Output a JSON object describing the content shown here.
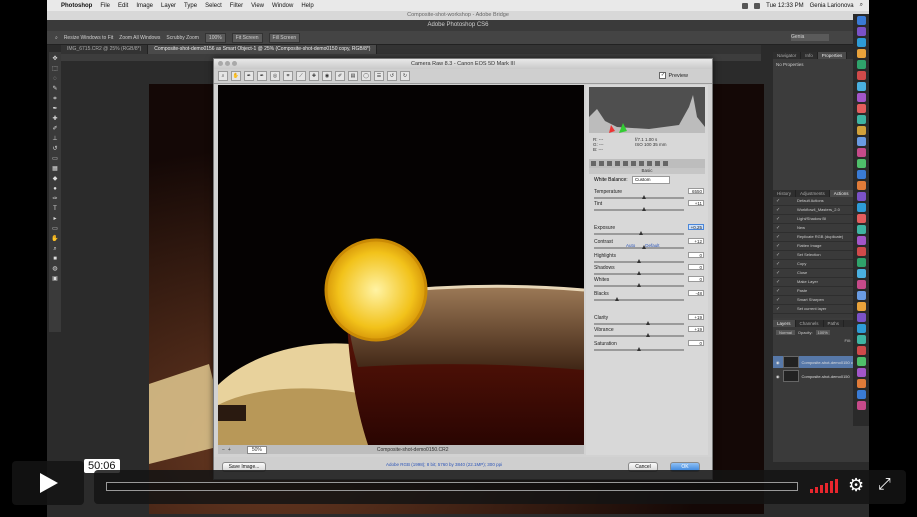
{
  "menubar": {
    "app": "Photoshop",
    "items": [
      "File",
      "Edit",
      "Image",
      "Layer",
      "Type",
      "Select",
      "Filter",
      "View",
      "Window",
      "Help"
    ],
    "clock": "Tue 12:33 PM",
    "user": "Genia Larionova"
  },
  "bridge_title": "Composite-shot-workshop - Adobe Bridge",
  "ps_title": "Adobe Photoshop CS6",
  "optbar": {
    "opt1": "Resize Windows to Fit",
    "opt2": "Zoom All Windows",
    "opt3": "Scrubby Zoom",
    "btn1": "100%",
    "btn2": "Fit Screen",
    "btn3": "Fill Screen",
    "workspace": "Genia"
  },
  "doc_tabs": [
    {
      "label": "IMG_6715.CR2 @ 25% (RGB/8*)"
    },
    {
      "label": "Composite-shot-demo0156 as Smart Object-1 @ 25% (Composite-shot-demo0150 copy, RGB/8*)"
    }
  ],
  "camera_raw": {
    "title": "Camera Raw 8.3  -  Canon EOS 5D Mark III",
    "preview_label": "Preview",
    "readout": {
      "r": "R: ---",
      "g": "G: ---",
      "b": "B: ---",
      "cam1": "f/7.1   1.00 s",
      "cam2": "ISO 100   35 mm"
    },
    "panel_title": "Basic",
    "white_balance_label": "White Balance:",
    "white_balance_value": "Custom",
    "auto_label": "Auto",
    "default_label": "Default",
    "controls": [
      {
        "label": "Temperature",
        "value": "6550",
        "pos": 0.55
      },
      {
        "label": "Tint",
        "value": "+11",
        "pos": 0.55
      },
      {
        "label": "Exposure",
        "value": "+0.25",
        "pos": 0.52,
        "highlight": true
      },
      {
        "label": "Contrast",
        "value": "+12",
        "pos": 0.56
      },
      {
        "label": "Highlights",
        "value": "0",
        "pos": 0.5
      },
      {
        "label": "Shadows",
        "value": "0",
        "pos": 0.5
      },
      {
        "label": "Whites",
        "value": "0",
        "pos": 0.5
      },
      {
        "label": "Blacks",
        "value": "-48",
        "pos": 0.26
      },
      {
        "label": "Clarity",
        "value": "+19",
        "pos": 0.6
      },
      {
        "label": "Vibrance",
        "value": "+19",
        "pos": 0.6
      },
      {
        "label": "Saturation",
        "value": "0",
        "pos": 0.5
      }
    ],
    "zoom": "50%",
    "filename": "Composite-shot-demo0150.CR2",
    "save_button": "Save Image...",
    "workflow_link": "Adobe RGB (1998); 8 bit; 5760 by 3840 (22.1MP); 300 ppi",
    "cancel_button": "Cancel",
    "ok_button": "OK"
  },
  "right_panel": {
    "tabs": [
      "Navigator",
      "Info",
      "Properties"
    ],
    "properties_text": "No Properties",
    "actions_tabs": [
      "History",
      "Adjustments",
      "Actions"
    ],
    "actions": [
      "Default Actions",
      "Workflow4_Masters_2.0",
      "Light/Shadow BI",
      "New",
      "Replicate RGB (duplicate)",
      "Flatten Image",
      "Set Selection",
      "Copy",
      "Close",
      "Make Layer",
      "Paste",
      "Smart Sharpen",
      "Set current layer"
    ],
    "layers_tabs": [
      "Layers",
      "Channels",
      "Paths"
    ],
    "blend_mode": "Normal",
    "opacity_label": "Opacity:",
    "opacity_value": "100%",
    "fill_label": "Fill:",
    "fill_value": "100%",
    "layers": [
      {
        "name": "Composite-shot-demo0150 copy",
        "selected": true
      },
      {
        "name": "Composite-shot-demo0150",
        "selected": false
      }
    ]
  },
  "video": {
    "timecode": "50:06",
    "progress": 0.0
  },
  "colors": {
    "accent_blue": "#3c86dc",
    "volume_red": "#e8262d"
  }
}
